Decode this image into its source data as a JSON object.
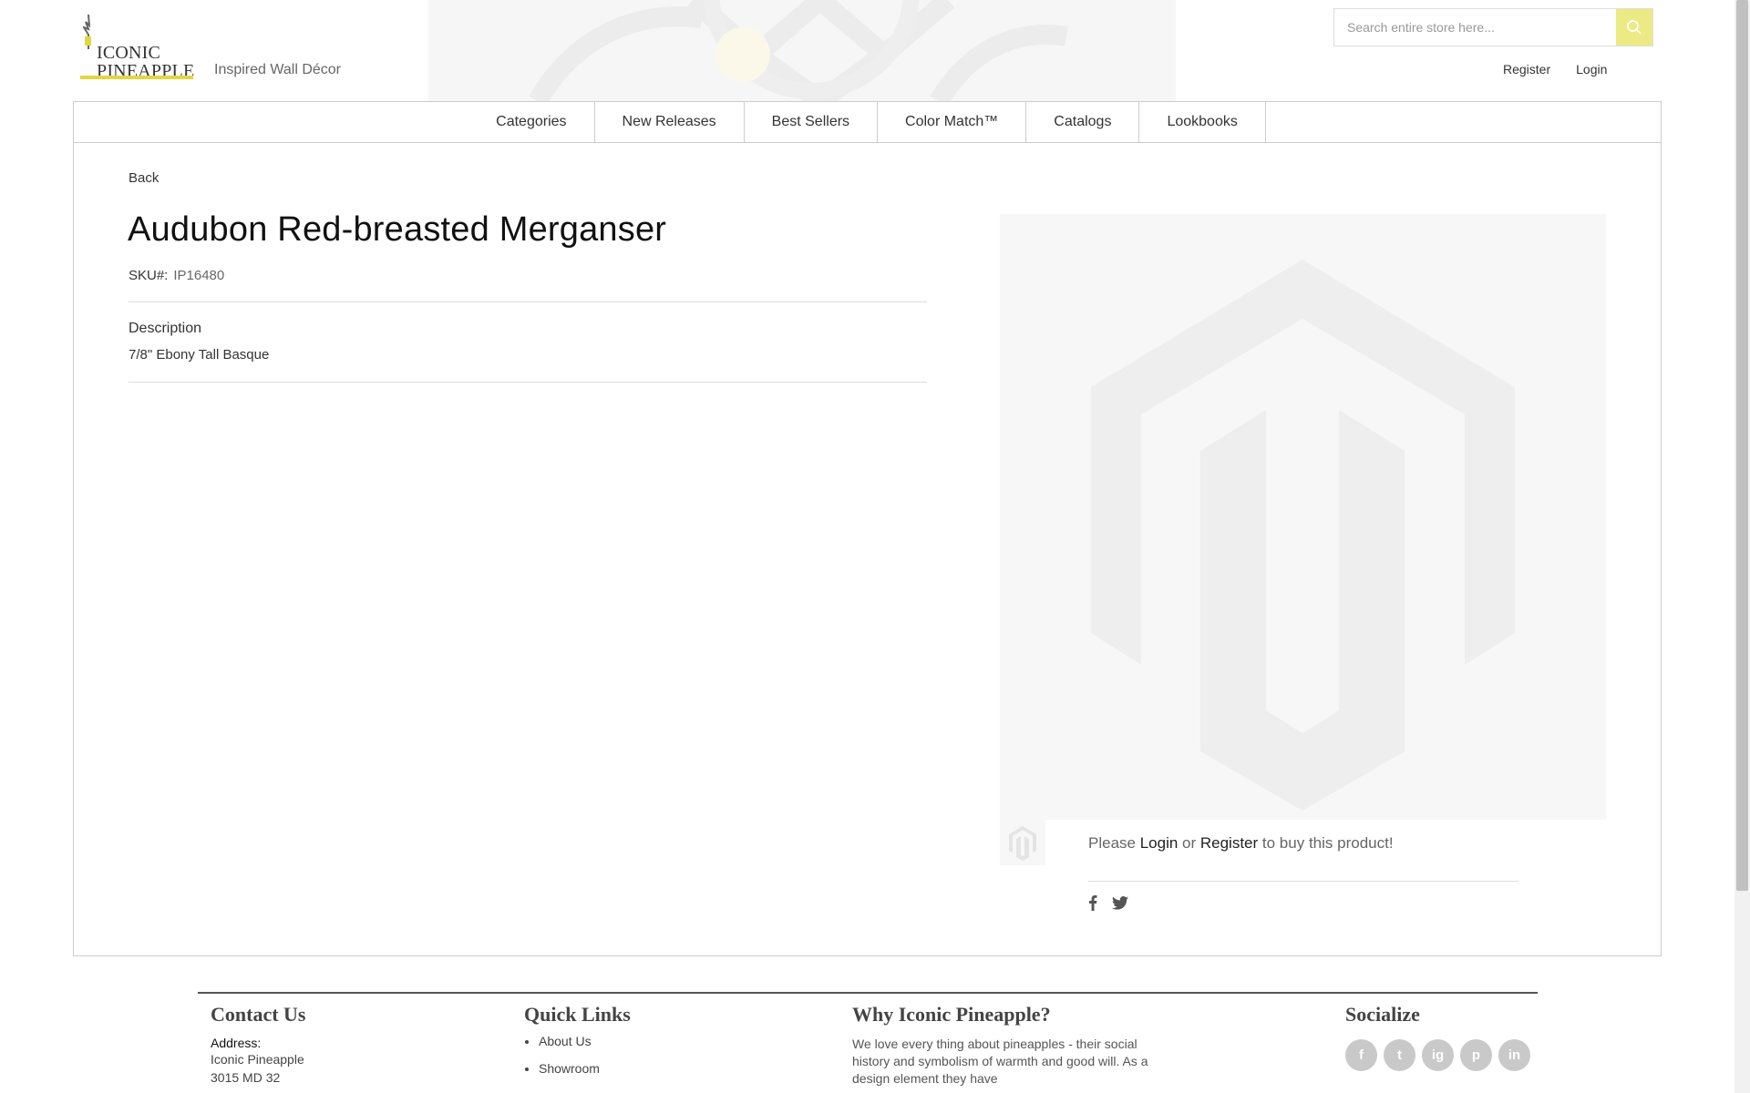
{
  "brand": {
    "logo_line1": "ICONIC",
    "logo_line2": "PINEAPPLE",
    "tagline": "Inspired Wall Décor",
    "accent_color": "#e3d641"
  },
  "search": {
    "placeholder": "Search entire store here..."
  },
  "account_links": {
    "register": "Register",
    "login": "Login"
  },
  "nav": {
    "items": [
      "Categories",
      "New Releases",
      "Best Sellers",
      "Color Match™",
      "Catalogs",
      "Lookbooks"
    ]
  },
  "product": {
    "back": "Back",
    "title": "Audubon Red-breasted Merganser",
    "sku_label": "SKU#:",
    "sku_value": "IP16480",
    "description_heading": "Description",
    "description_text": "7/8\" Ebony Tall Basque"
  },
  "buy": {
    "pre": "Please ",
    "login": "Login",
    "mid": " or ",
    "register": "Register",
    "post": " to buy this product!"
  },
  "share_icons": [
    "facebook-icon",
    "twitter-icon"
  ],
  "footer": {
    "contact": {
      "heading": "Contact Us",
      "address_label": "Address:",
      "address_lines": [
        "Iconic Pineapple",
        "3015 MD 32"
      ]
    },
    "quick_links": {
      "heading": "Quick Links",
      "items": [
        "About Us",
        "Showroom"
      ]
    },
    "why": {
      "heading": "Why Iconic Pineapple?",
      "text": "We love every thing about pineapples - their social history and symbolism of warmth and good will. As a design element they have"
    },
    "socialize": {
      "heading": "Socialize",
      "icons": [
        "f",
        "t",
        "ig",
        "p",
        "in"
      ]
    }
  }
}
